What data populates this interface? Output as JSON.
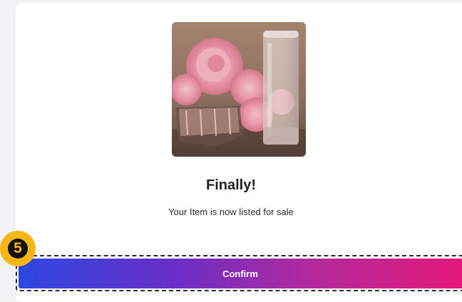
{
  "dialog": {
    "title": "Finally!",
    "message": "Your Item is now listed for sale",
    "image_icon": "artwork-roses-glass-image"
  },
  "confirm": {
    "label": "Confirm",
    "gradient": [
      "#2c47e0",
      "#6a2ec8",
      "#b02a9e",
      "#e4187a"
    ]
  },
  "step_marker": {
    "number": "5",
    "color": "#f6b617"
  }
}
